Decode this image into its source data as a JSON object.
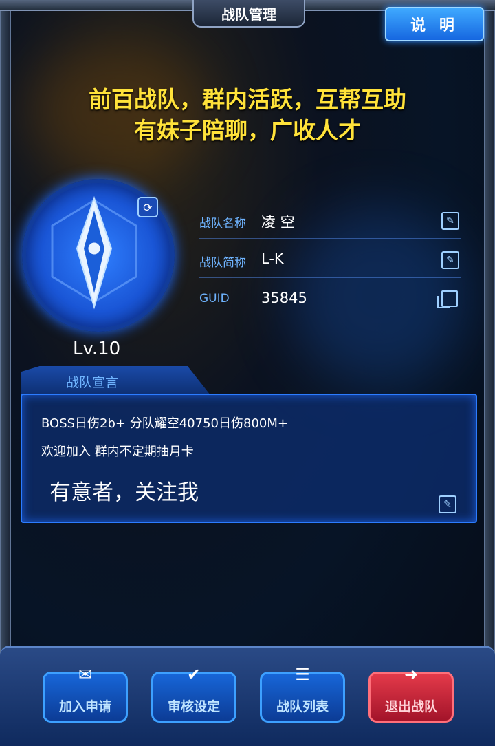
{
  "header": {
    "title": "战队管理",
    "help_label": "说 明"
  },
  "slogan": {
    "line1": "前百战队，群内活跃，互帮互助",
    "line2": "有妹子陪聊，广收人才"
  },
  "team": {
    "level": "Lv.10",
    "name_label": "战队名称",
    "name_value": "凌 空",
    "short_label": "战队简称",
    "short_value": "L-K",
    "guid_label": "GUID",
    "guid_value": "35845"
  },
  "declaration": {
    "tab_label": "战队宣言",
    "line1": "BOSS日伤2b+  分队耀空40750日伤800M+",
    "line2": "欢迎加入  群内不定期抽月卡",
    "line3": "有意者，关注我"
  },
  "bottom_nav": {
    "join_requests": "加入申请",
    "review_settings": "审核设定",
    "team_list": "战队列表",
    "leave_team": "退出战队"
  },
  "colors": {
    "slogan": "#ffe23a",
    "label_blue": "#6fb4ff",
    "accent_blue": "#2c7cff",
    "leave_red": "#e43a4a"
  },
  "icons": {
    "help": "help-button",
    "refresh": "refresh-icon",
    "edit": "edit-icon",
    "copy": "copy-icon",
    "join": "mail-icon",
    "review": "check-icon",
    "list": "list-icon",
    "leave": "exit-icon"
  }
}
